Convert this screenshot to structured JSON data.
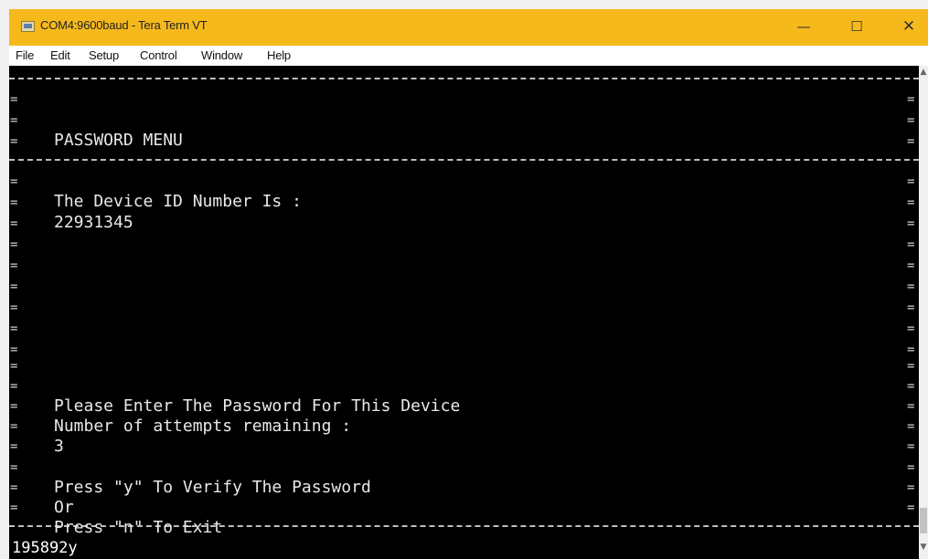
{
  "window": {
    "title": "COM4:9600baud - Tera Term VT",
    "controls": {
      "minimize": "—",
      "maximize": "☐",
      "close": "✕"
    }
  },
  "menu": {
    "file": "File",
    "edit": "Edit",
    "setup": "Setup",
    "control": "Control",
    "window": "Window",
    "help": "Help"
  },
  "terminal": {
    "border_char": "=",
    "header": "PASSWORD MENU",
    "device_id_label": "The Device ID Number Is :",
    "device_id": "22931345",
    "prompt": "Please Enter The Password For This Device",
    "attempts_label": "Number of attempts remaining :",
    "attempts": "3",
    "verify_option": "Press \"y\" To Verify The Password",
    "or_text": "Or",
    "exit_option": "Press \"n\" To Exit",
    "input_line": "195892y"
  },
  "scrollbar": {
    "up": "▲",
    "down": "▼"
  }
}
